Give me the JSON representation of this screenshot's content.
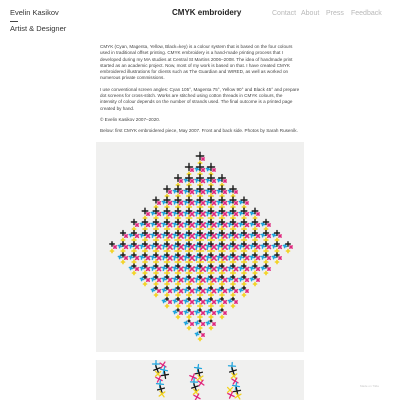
{
  "header": {
    "artist_name": "Evelin Kasikov",
    "artist_role": "Artist & Designer",
    "page_title": "CMYK embroidery",
    "nav": [
      "Contact",
      "About",
      "Press",
      "Feedback"
    ]
  },
  "article": {
    "paragraphs": [
      "CMYK (Cyan, Magenta, Yellow, Black=key) is a colour system that is based on the four colours used in traditional offset printing. CMYK embroidery is a hand-made printing process that I developed during my MA studies at Central St Martins 2006–2008. The idea of handmade print started as an academic project. Now, most of my work is based on that. I have created CMYK embroidered illustrations for clients such as The Guardian and WIRED, as well as worked on numerous private commissions.",
      "I use conventional screen angles: Cyan 105°, Magenta 75°, Yellow 90° and Black 45° and prepare dot screens for cross-stitch. Works are stitched using cotton threads in CMYK colours, the intensity of colour depends on the number of strands used. The final outcome is a printed page created by hand.",
      "© Evelin Kasikov 2007–2020.",
      "Below: first CMYK embroidered piece, May 2007. Front and back side. Photos by Sarah Ruseník."
    ]
  },
  "footer": {
    "note": "Made on Tilda"
  },
  "colors": {
    "cyan": "#21a5dd",
    "magenta": "#e0287e",
    "yellow": "#f3d21f",
    "black": "#1a1a1a",
    "photo_bg": "#f0f0ef",
    "nav": "#b8b8b8"
  }
}
